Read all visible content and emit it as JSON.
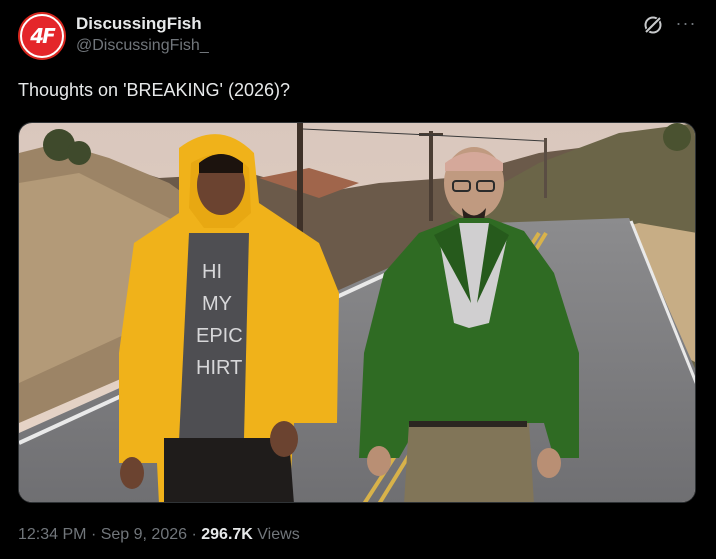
{
  "author": {
    "name": "DiscussingFish",
    "handle": "@DiscussingFish_",
    "avatar_text": "4F"
  },
  "tweet": {
    "text": "Thoughts on 'BREAKING' (2026)?"
  },
  "media": {
    "shirt_lines": [
      "HI",
      "MY",
      "EPIC",
      "HIRT"
    ]
  },
  "meta": {
    "time": "12:34 PM",
    "date": "Sep 9, 2026",
    "views_count": "296.7K",
    "views_label": "Views",
    "separator": "·"
  },
  "icons": {
    "grok": "grok-icon",
    "more": "more-icon"
  },
  "colors": {
    "background": "#000000",
    "text_primary": "#e7e9ea",
    "text_secondary": "#71767b",
    "avatar_red": "#e4262a",
    "hoodie_yellow": "#f0b21a",
    "jacket_green": "#2f6b23"
  }
}
